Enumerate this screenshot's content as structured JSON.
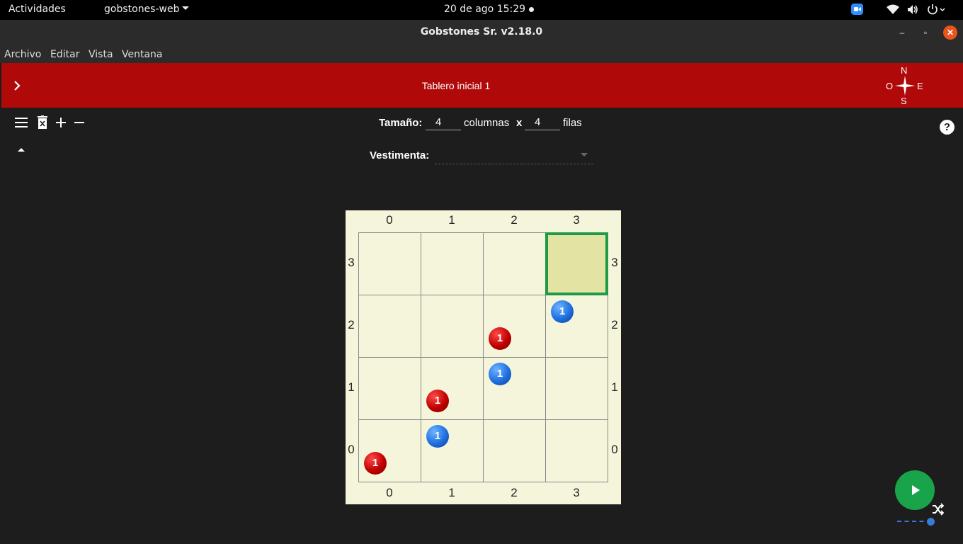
{
  "system_bar": {
    "activities": "Actividades",
    "app_name": "gobstones-web",
    "clock": "20 de ago  15:29"
  },
  "window": {
    "title": "Gobstones Sr. v2.18.0",
    "close_label": "✕",
    "min_label": "–",
    "max_label": "▫"
  },
  "menu": {
    "items": [
      "Archivo",
      "Editar",
      "Vista",
      "Ventana"
    ]
  },
  "header": {
    "expand_icon": "chevron-right-icon",
    "title": "Tablero inicial 1",
    "compass": {
      "n": "N",
      "s": "S",
      "e": "E",
      "w": "O"
    }
  },
  "toolbar": {
    "size_label": "Tamaño:",
    "columns_value": "4",
    "columns_label": "columnas",
    "times": "x",
    "rows_value": "4",
    "rows_label": "filas",
    "clothing_label": "Vestimenta:",
    "clothing_value": "",
    "help": "?"
  },
  "board": {
    "columns": [
      "0",
      "1",
      "2",
      "3"
    ],
    "rows": [
      "3",
      "2",
      "1",
      "0"
    ],
    "header_color": "#f5f5dc",
    "current_cell": {
      "col": 3,
      "row": 3
    },
    "balls": [
      {
        "col": 0,
        "row": 0,
        "color": "red",
        "count": "1"
      },
      {
        "col": 1,
        "row": 0,
        "color": "blue",
        "count": "1"
      },
      {
        "col": 1,
        "row": 1,
        "color": "red",
        "count": "1"
      },
      {
        "col": 2,
        "row": 1,
        "color": "blue",
        "count": "1"
      },
      {
        "col": 2,
        "row": 2,
        "color": "red",
        "count": "1"
      },
      {
        "col": 3,
        "row": 2,
        "color": "blue",
        "count": "1"
      }
    ]
  },
  "colors": {
    "header_red": "#b00909",
    "run_green": "#19a34a",
    "cursor_green": "#1e9a48",
    "board_bg": "#f5f5dc"
  }
}
